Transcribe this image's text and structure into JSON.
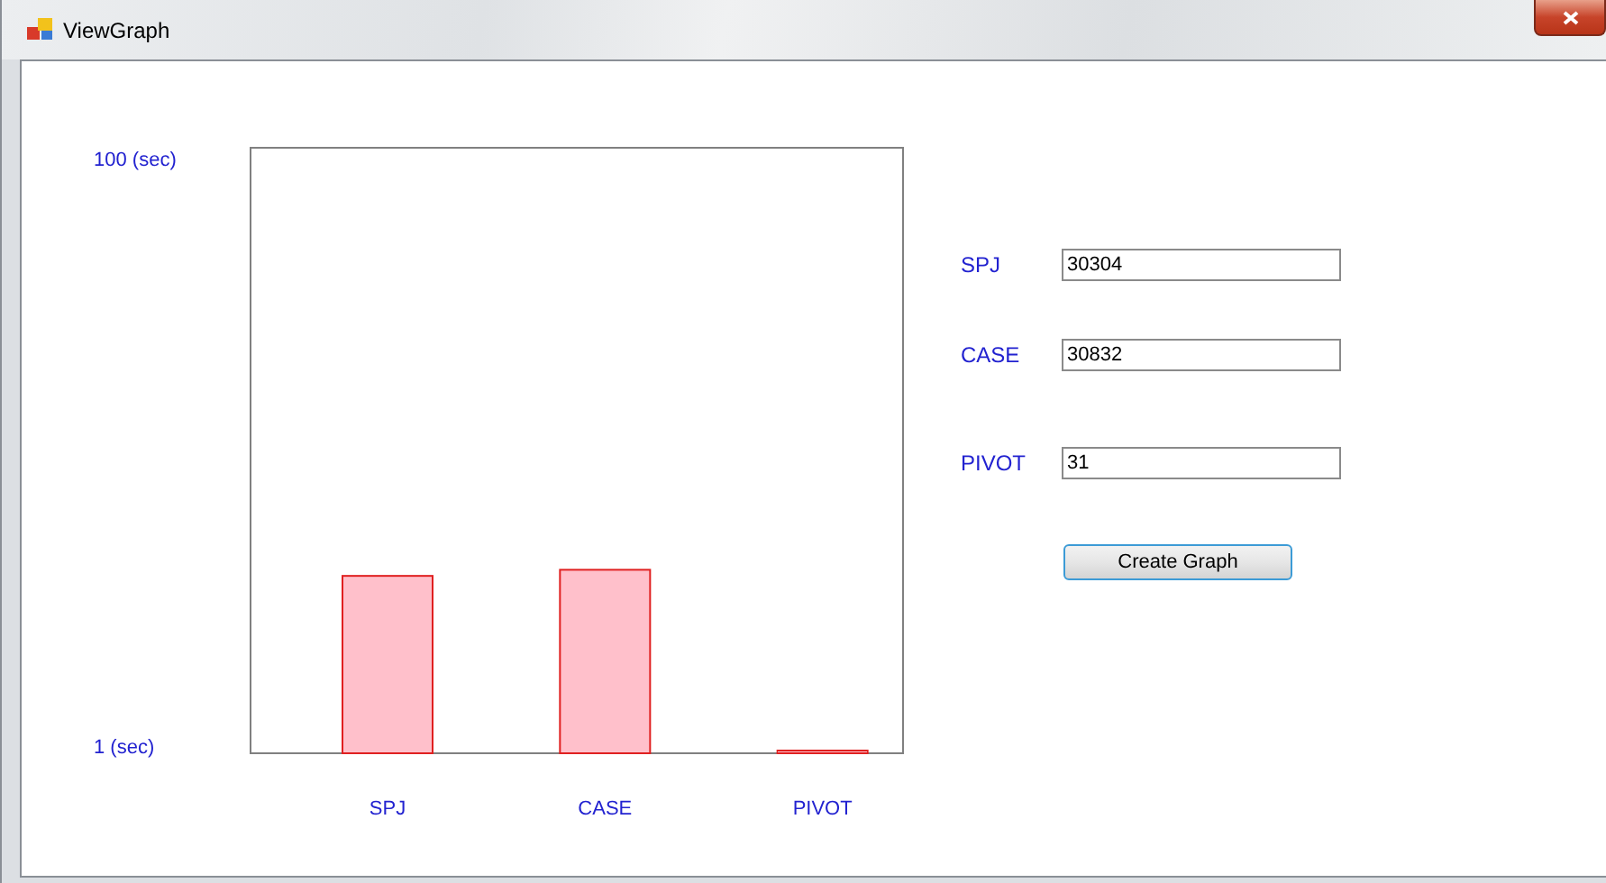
{
  "window": {
    "title": "ViewGraph"
  },
  "chart": {
    "chart_data": {
      "type": "bar",
      "categories": [
        "SPJ",
        "CASE",
        "PIVOT"
      ],
      "ylim": [
        1,
        100
      ],
      "yticks": [
        {
          "value": 1,
          "label": "1 (sec)"
        },
        {
          "value": 100,
          "label": "100 (sec)"
        }
      ],
      "series": [
        {
          "color": "#ffc0cb",
          "values": [
            30,
            31,
            1
          ]
        }
      ]
    }
  },
  "form": {
    "fields": [
      {
        "label": "SPJ",
        "value": "30304"
      },
      {
        "label": "CASE",
        "value": "30832"
      },
      {
        "label": "PIVOT",
        "value": "31"
      }
    ],
    "button": "Create Graph"
  }
}
